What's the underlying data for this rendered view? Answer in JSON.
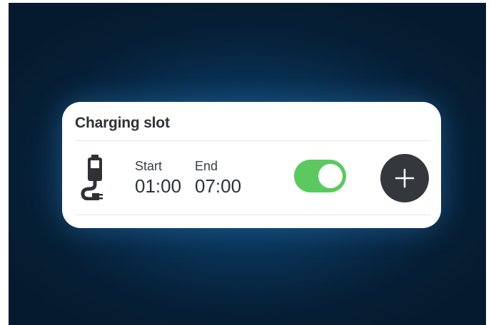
{
  "card": {
    "title": "Charging slot"
  },
  "slot": {
    "icon": "battery-plug-icon",
    "start_label": "Start",
    "start_value": "01:00",
    "end_label": "End",
    "end_value": "07:00",
    "enabled": true,
    "toggle_color": "#5bc95f",
    "add_icon": "plus-icon"
  }
}
